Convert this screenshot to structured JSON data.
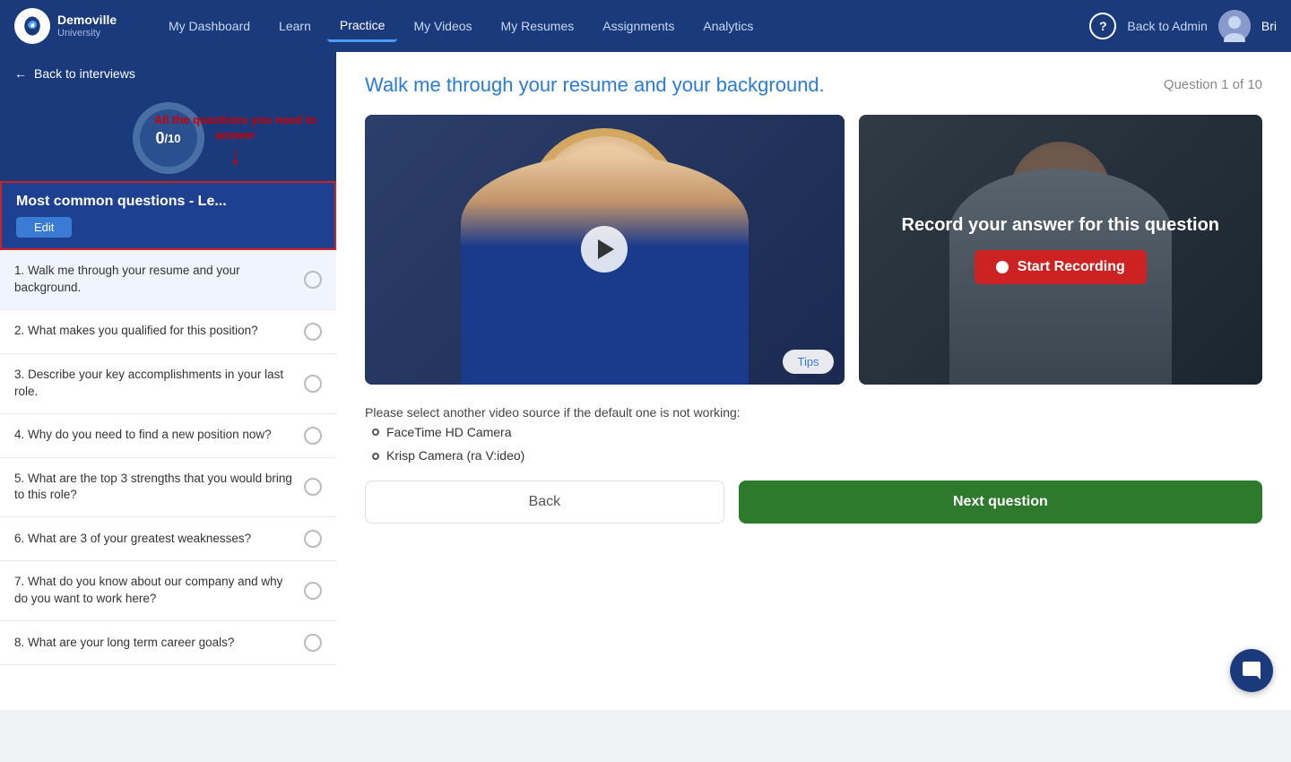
{
  "nav": {
    "logo_brand": "Demoville",
    "logo_sub": "University",
    "links": [
      {
        "label": "My Dashboard",
        "id": "my-dashboard",
        "active": false
      },
      {
        "label": "Learn",
        "id": "learn",
        "active": false
      },
      {
        "label": "Practice",
        "id": "practice",
        "active": true
      },
      {
        "label": "My Videos",
        "id": "my-videos",
        "active": false
      },
      {
        "label": "My Resumes",
        "id": "my-resumes",
        "active": false
      },
      {
        "label": "Assignments",
        "id": "assignments",
        "active": false
      },
      {
        "label": "Analytics",
        "id": "analytics",
        "active": false
      }
    ],
    "back_admin_label": "Back to Admin",
    "user_name": "Bri"
  },
  "sidebar": {
    "back_label": "Back to interviews",
    "progress_current": "0",
    "progress_separator": "/",
    "progress_total": "10",
    "annotation_text": "All the questions you need to answer",
    "questions_title": "Most common questions - Le...",
    "edit_label": "Edit",
    "questions": [
      {
        "num": 1,
        "text": "Walk me through your resume and your background.",
        "checked": false
      },
      {
        "num": 2,
        "text": "What makes you qualified for this position?",
        "checked": false
      },
      {
        "num": 3,
        "text": "Describe your key accomplishments in your last role.",
        "checked": false
      },
      {
        "num": 4,
        "text": "Why do you need to find a new position now?",
        "checked": false
      },
      {
        "num": 5,
        "text": "What are the top 3 strengths that you would bring to this role?",
        "checked": false
      },
      {
        "num": 6,
        "text": "What are 3 of your greatest weaknesses?",
        "checked": false
      },
      {
        "num": 7,
        "text": "What do you know about our company and why do you want to work here?",
        "checked": false
      },
      {
        "num": 8,
        "text": "What are your long term career goals?",
        "checked": false
      }
    ]
  },
  "content": {
    "question_text": "Walk me through your resume and your background.",
    "question_count": "Question 1 of 10",
    "tips_label": "Tips",
    "record_title": "Record your answer for this question",
    "start_recording_label": "Start Recording",
    "camera_source_text": "Please select another video source if the default one is not working:",
    "camera_options": [
      "FaceTime HD Camera",
      "Krisp Camera (ra V:ideo)"
    ],
    "back_label": "Back",
    "next_label": "Next question"
  }
}
